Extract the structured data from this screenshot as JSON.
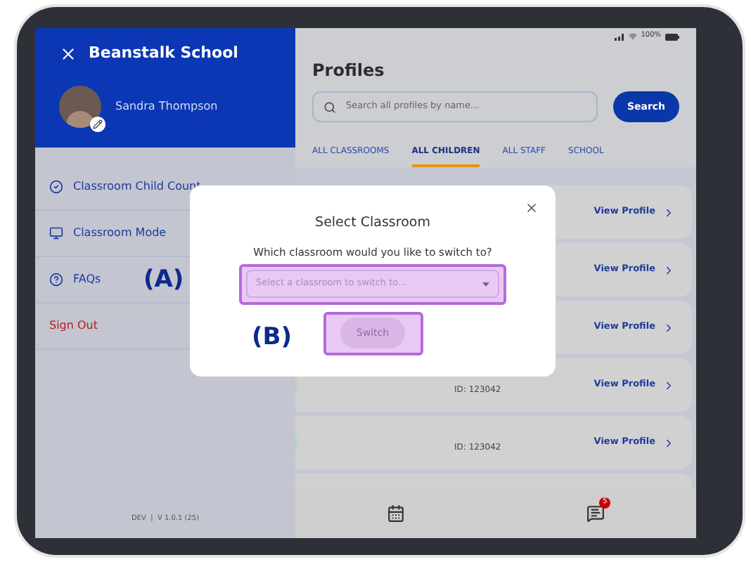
{
  "sidebar": {
    "school": "Beanstalk School",
    "user": "Sandra Thompson",
    "menu": [
      {
        "label": "Classroom Child Count",
        "kind": "check"
      },
      {
        "label": "Classroom Mode",
        "kind": "mode"
      },
      {
        "label": "FAQs",
        "kind": "help"
      },
      {
        "label": "Sign Out",
        "kind": "danger"
      }
    ],
    "version": "DEV  |  V 1.0.1 (25)"
  },
  "status_bar": {
    "battery": "100%"
  },
  "profiles": {
    "title": "Profiles",
    "search": {
      "placeholder": "Search all profiles by name..."
    },
    "search_button": "Search",
    "tabs": [
      {
        "label": "ALL CLASSROOMS",
        "selected": false
      },
      {
        "label": "ALL CHILDREN",
        "selected": true
      },
      {
        "label": "ALL STAFF",
        "selected": false
      },
      {
        "label": "SCHOOL",
        "selected": false
      }
    ],
    "rows": [
      {
        "link": "View Profile"
      },
      {
        "link": "View Profile"
      },
      {
        "link": "View Profile"
      },
      {
        "id": "ID: 123042",
        "link": "View Profile"
      },
      {
        "id": "ID: 123042",
        "link": "View Profile"
      }
    ]
  },
  "bottom_nav": {
    "badge": "5"
  },
  "dialog": {
    "title": "Select Classroom",
    "question": "Which classroom would you like to switch to?",
    "select": {
      "placeholder": "Select a classroom to switch to..."
    },
    "button": {
      "label": "Switch",
      "disabled": true
    }
  },
  "annotations": [
    {
      "label": "(A)"
    },
    {
      "label": "(B)"
    }
  ]
}
